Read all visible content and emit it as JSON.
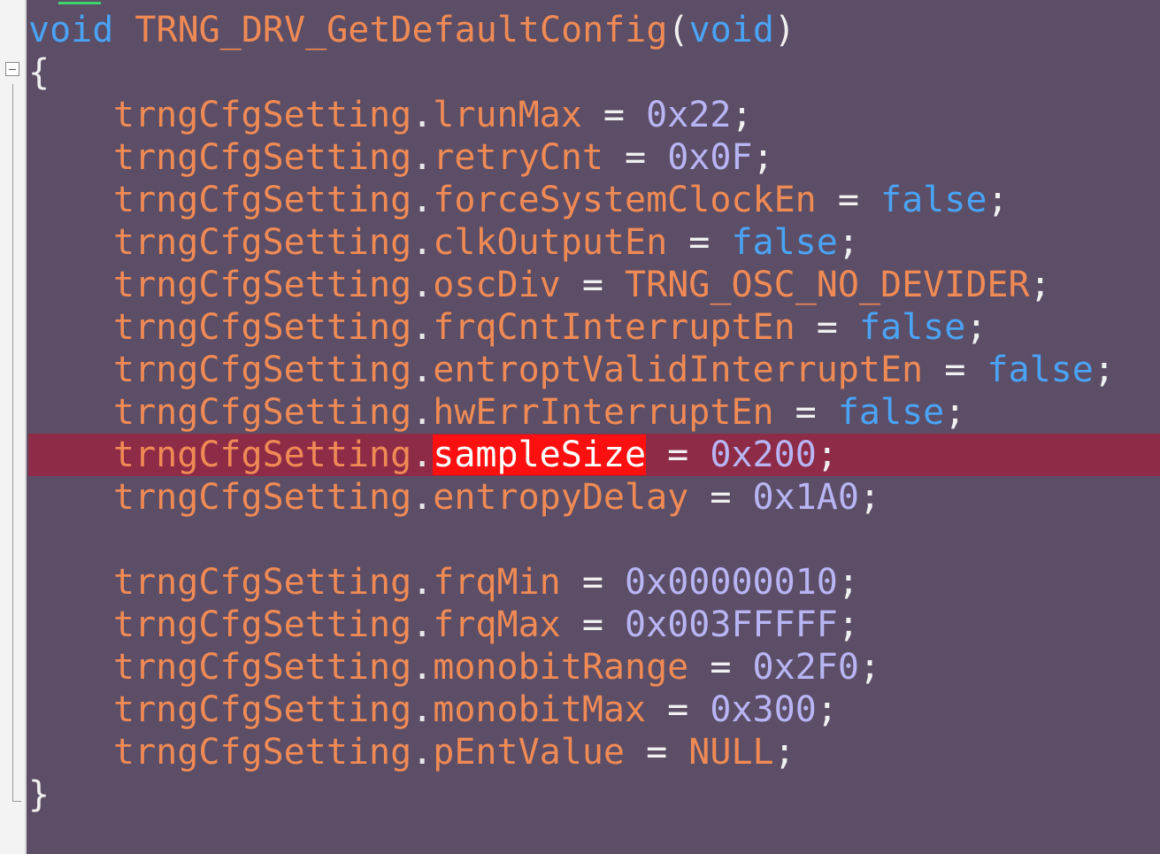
{
  "signature": {
    "return_type": "void",
    "name": "TRNG_DRV_GetDefaultConfig",
    "open_paren": "(",
    "param": "void",
    "close_paren": ")"
  },
  "open_brace": "{",
  "close_brace": "}",
  "object": "trngCfgSetting",
  "dot": ".",
  "equals": "=",
  "semicolon": ";",
  "selected_field": "sampleSize",
  "assignments": [
    {
      "field": "lrunMax",
      "value": "0x22",
      "kind": "num"
    },
    {
      "field": "retryCnt",
      "value": "0x0F",
      "kind": "num"
    },
    {
      "field": "forceSystemClockEn",
      "value": "false",
      "kind": "kw"
    },
    {
      "field": "clkOutputEn",
      "value": "false",
      "kind": "kw"
    },
    {
      "field": "oscDiv",
      "value": "TRNG_OSC_NO_DEVIDER",
      "kind": "const"
    },
    {
      "field": "frqCntInterruptEn",
      "value": "false",
      "kind": "kw"
    },
    {
      "field": "entroptValidInterruptEn",
      "value": "false",
      "kind": "kw"
    },
    {
      "field": "hwErrInterruptEn",
      "value": "false",
      "kind": "kw"
    },
    {
      "field": "sampleSize",
      "value": "0x200",
      "kind": "num"
    },
    {
      "field": "entropyDelay",
      "value": "0x1A0",
      "kind": "num"
    },
    {
      "field": "frqMin",
      "value": "0x00000010",
      "kind": "num"
    },
    {
      "field": "frqMax",
      "value": "0x003FFFFF",
      "kind": "num"
    },
    {
      "field": "monobitRange",
      "value": "0x2F0",
      "kind": "num"
    },
    {
      "field": "monobitMax",
      "value": "0x300",
      "kind": "num"
    },
    {
      "field": "pEntValue",
      "value": "NULL",
      "kind": "const"
    }
  ],
  "colors": {
    "background": "#5c4e66",
    "highlight_line": "#8e2b46",
    "selection": "#ff1010",
    "keyword": "#4aa3f5",
    "identifier": "#f08a55",
    "number": "#b8b5f5"
  }
}
